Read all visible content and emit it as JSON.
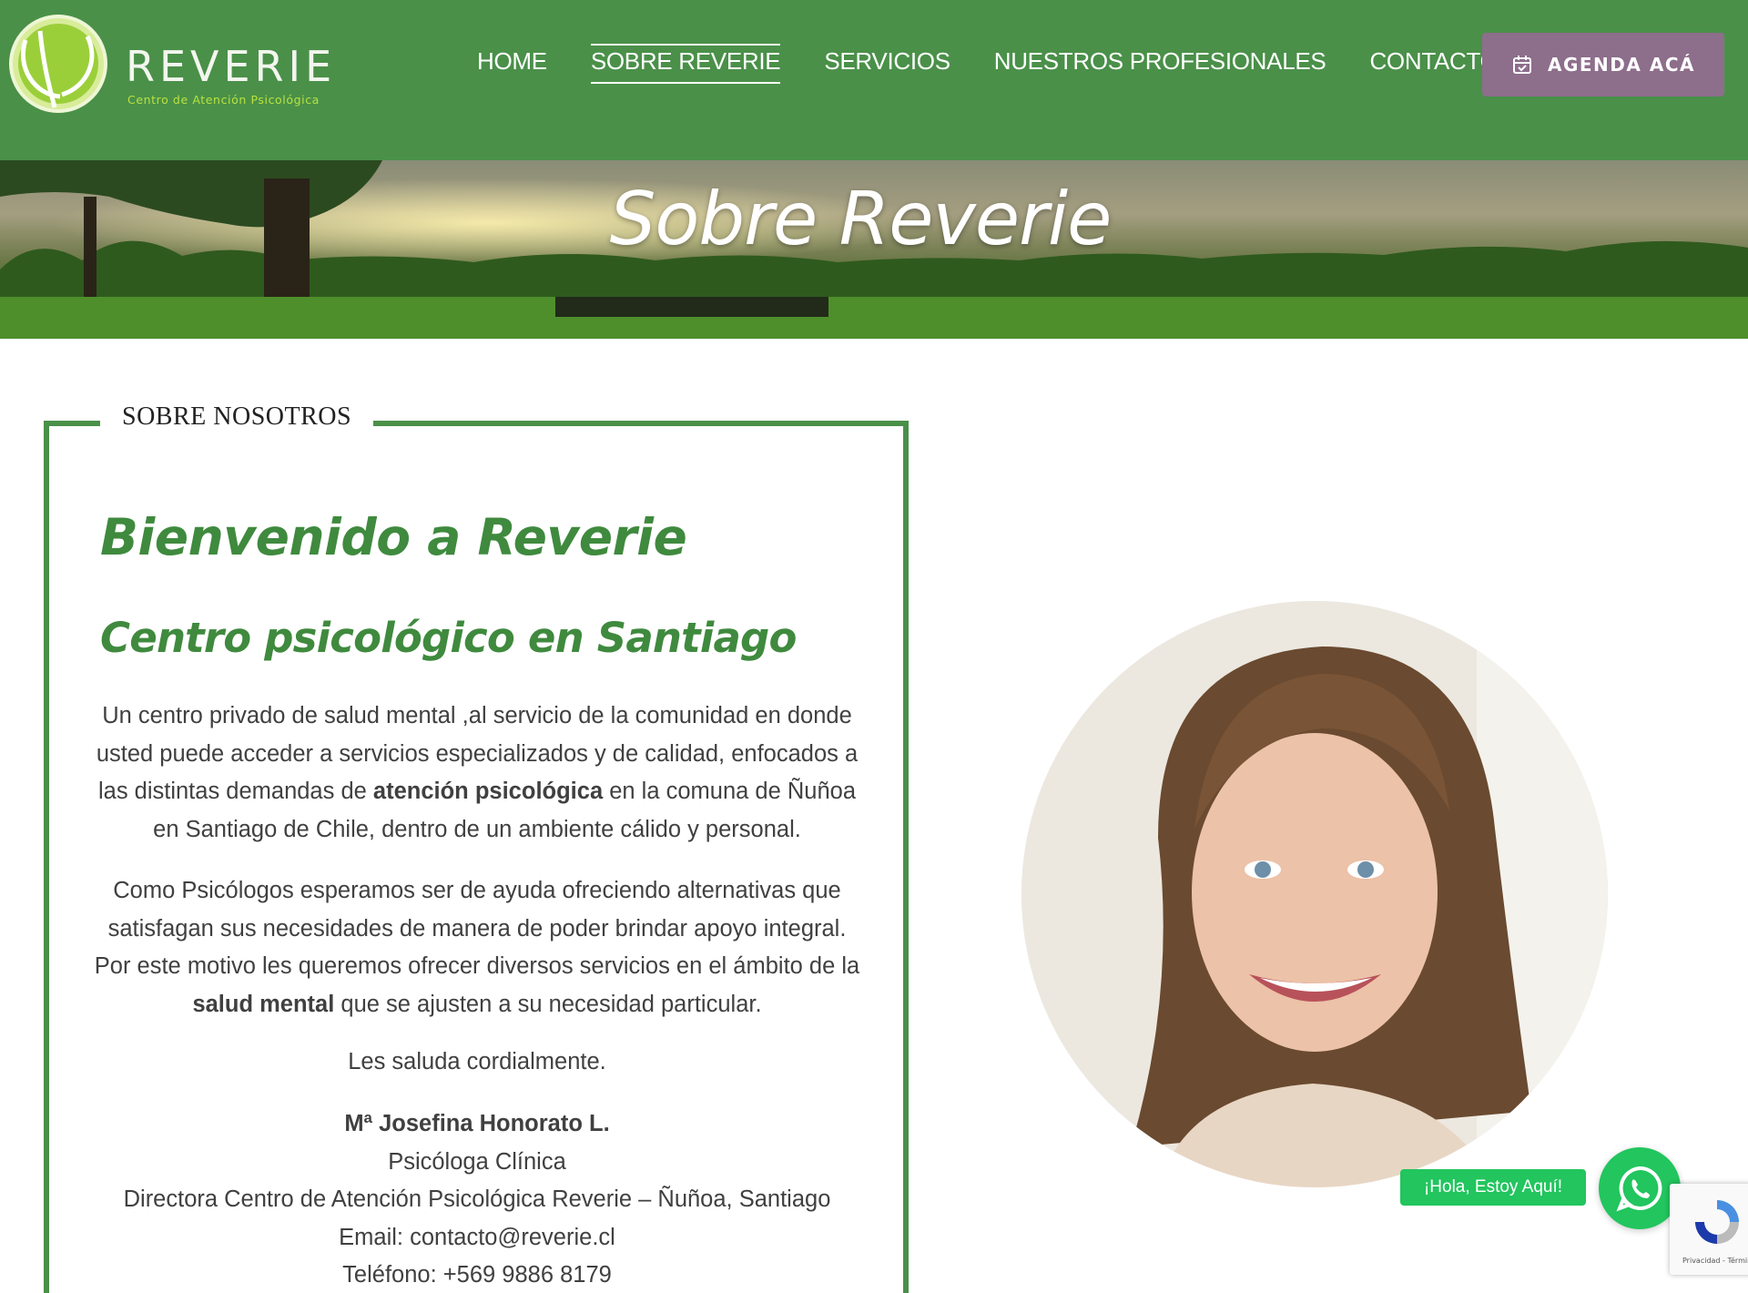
{
  "brand": {
    "name": "REVERIE",
    "tagline": "Centro de Atención Psicológica"
  },
  "nav": {
    "items": [
      {
        "label": "HOME",
        "active": false
      },
      {
        "label": "SOBRE REVERIE",
        "active": true
      },
      {
        "label": "SERVICIOS",
        "active": false
      },
      {
        "label": "NUESTROS PROFESIONALES",
        "active": false
      },
      {
        "label": "CONTACTO",
        "active": false
      }
    ],
    "cta_label": "AGENDA ACÁ",
    "cta_icon": "calendar-check-icon"
  },
  "hero": {
    "title": "Sobre Reverie"
  },
  "about": {
    "legend": "SOBRE NOSOTROS",
    "welcome": "Bienvenido a Reverie",
    "subheading": "Centro psicológico en Santiago",
    "p1_a": "Un centro privado de salud mental ,al servicio de la comunidad en donde usted puede acceder a servicios especializados y de calidad, enfocados a las distintas demandas de ",
    "p1_bold": "atención psicológica",
    "p1_b": " en la comuna de Ñuñoa en Santiago de Chile, dentro de un ambiente cálido y personal.",
    "p2_a": "Como Psicólogos esperamos ser de ayuda ofreciendo alternativas que satisfagan sus necesidades de manera de poder brindar apoyo integral. Por este motivo les queremos ofrecer diversos servicios en el ámbito de la ",
    "p2_bold": "salud mental",
    "p2_b": " que se ajusten a su necesidad particular.",
    "greeting": "Les saluda cordialmente.",
    "signature": {
      "name": "Mª Josefina Honorato L.",
      "role": "Psicóloga Clínica",
      "position": "Directora Centro de Atención Psicológica Reverie – Ñuñoa, Santiago",
      "email": "Email: contacto@reverie.cl",
      "phone": "Teléfono: +569 9886 8179"
    }
  },
  "whatsapp": {
    "label": "¡Hola, Estoy Aquí!",
    "icon": "whatsapp-icon"
  },
  "recaptcha": {
    "text": "Privacidad - Términos"
  },
  "colors": {
    "brand_green": "#4a9049",
    "heading_green": "#3f8a3e",
    "cta_purple": "#8d6e8b",
    "whatsapp_green": "#22c55e"
  }
}
